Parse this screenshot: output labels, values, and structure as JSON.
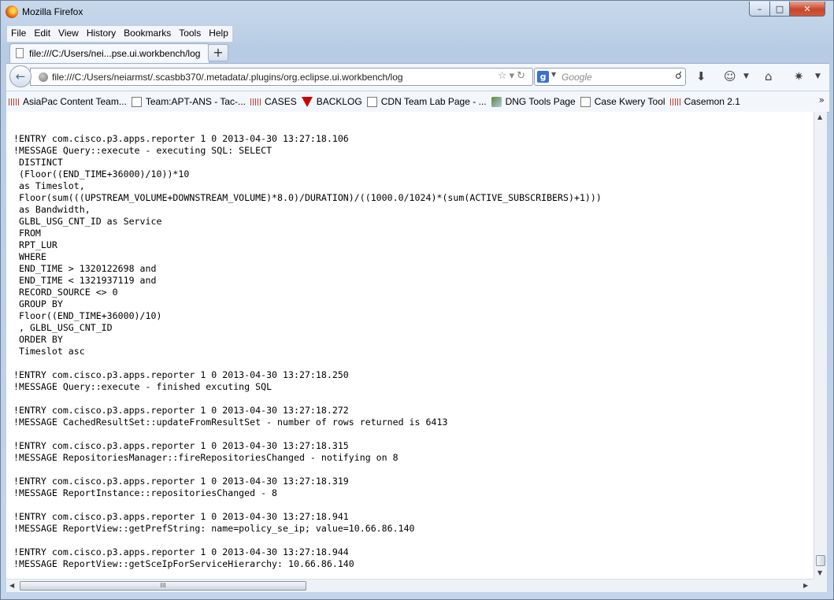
{
  "window": {
    "title": "Mozilla Firefox",
    "controls": {
      "minimize": "–",
      "maximize": "□",
      "close": "✕"
    }
  },
  "menu": [
    "File",
    "Edit",
    "View",
    "History",
    "Bookmarks",
    "Tools",
    "Help"
  ],
  "tab": {
    "title": "file:///C:/Users/nei...pse.ui.workbench/log",
    "new_tab": "+"
  },
  "nav": {
    "url": "file:///C:/Users/neiarmst/.scasbb370/.metadata/.plugins/org.eclipse.ui.workbench/log",
    "url_icons": "☆▾↻",
    "search_engine": "g",
    "search_placeholder": "Google",
    "back_glyph": "←",
    "icons": [
      "download-icon",
      "addon-icon",
      "home-icon",
      "bug-icon"
    ]
  },
  "bookmarks": [
    {
      "label": "AsiaPac Content Team...",
      "icon": "cisco"
    },
    {
      "label": "Team:APT-ANS - Tac-...",
      "icon": "blank"
    },
    {
      "label": "CASES",
      "icon": "cisco"
    },
    {
      "label": "BACKLOG",
      "icon": "flag"
    },
    {
      "label": "CDN Team Lab Page - ...",
      "icon": "blank"
    },
    {
      "label": "DNG Tools Page",
      "icon": "tools"
    },
    {
      "label": "Case Kwery Tool",
      "icon": "blank"
    },
    {
      "label": "Casemon 2.1",
      "icon": "cisco"
    }
  ],
  "bookmarks_overflow": "»",
  "log_text": "!ENTRY com.cisco.p3.apps.reporter 1 0 2013-04-30 13:27:18.106\n!MESSAGE Query::execute - executing SQL: SELECT\n DISTINCT\n (Floor((END_TIME+36000)/10))*10\n as Timeslot,\n Floor(sum(((UPSTREAM_VOLUME+DOWNSTREAM_VOLUME)*8.0)/DURATION)/((1000.0/1024)*(sum(ACTIVE_SUBSCRIBERS)+1)))\n as Bandwidth,\n GLBL_USG_CNT_ID as Service\n FROM\n RPT_LUR\n WHERE\n END_TIME > 1320122698 and\n END_TIME < 1321937119 and\n RECORD_SOURCE <> 0\n GROUP BY\n Floor((END_TIME+36000)/10)\n , GLBL_USG_CNT_ID\n ORDER BY\n Timeslot asc\n\n!ENTRY com.cisco.p3.apps.reporter 1 0 2013-04-30 13:27:18.250\n!MESSAGE Query::execute - finished excuting SQL\n\n!ENTRY com.cisco.p3.apps.reporter 1 0 2013-04-30 13:27:18.272\n!MESSAGE CachedResultSet::updateFromResultSet - number of rows returned is 6413\n\n!ENTRY com.cisco.p3.apps.reporter 1 0 2013-04-30 13:27:18.315\n!MESSAGE RepositoriesManager::fireRepositoriesChanged - notifying on 8\n\n!ENTRY com.cisco.p3.apps.reporter 1 0 2013-04-30 13:27:18.319\n!MESSAGE ReportInstance::repositoriesChanged - 8\n\n!ENTRY com.cisco.p3.apps.reporter 1 0 2013-04-30 13:27:18.941\n!MESSAGE ReportView::getPrefString: name=policy_se_ip; value=10.66.86.140\n\n!ENTRY com.cisco.p3.apps.reporter 1 0 2013-04-30 13:27:18.944\n!MESSAGE ReportView::getSceIpForServiceHierarchy: 10.66.86.140",
  "scroll": {
    "grip": "III",
    "up": "▲",
    "down": "▼",
    "left": "◀",
    "right": "▶"
  }
}
